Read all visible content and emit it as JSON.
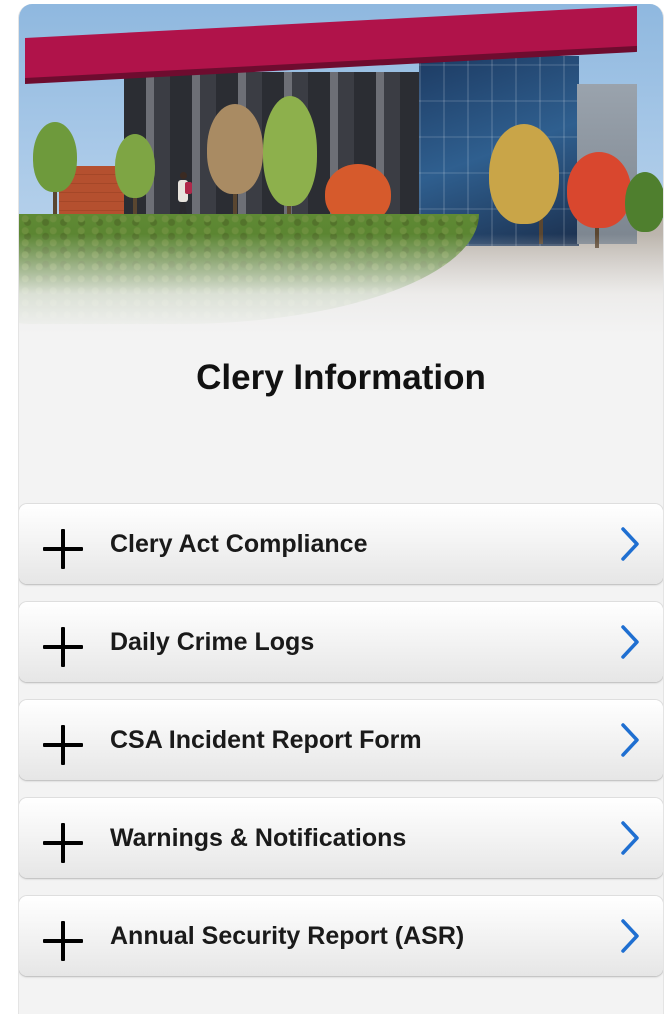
{
  "hero": {
    "image_subject": "campus building photo"
  },
  "page": {
    "title": "Clery Information"
  },
  "accordion": {
    "items": [
      {
        "label": "Clery Act Compliance",
        "icon": "plus-icon",
        "action_icon": "chevron-right-icon"
      },
      {
        "label": "Daily Crime Logs",
        "icon": "plus-icon",
        "action_icon": "chevron-right-icon"
      },
      {
        "label": "CSA Incident Report Form",
        "icon": "plus-icon",
        "action_icon": "chevron-right-icon"
      },
      {
        "label": "Warnings & Notifications",
        "icon": "plus-icon",
        "action_icon": "chevron-right-icon"
      },
      {
        "label": "Annual Security Report (ASR)",
        "icon": "plus-icon",
        "action_icon": "chevron-right-icon"
      }
    ]
  },
  "colors": {
    "accent_chevron": "#1f6fd1",
    "plus": "#000000",
    "building_roof": "#b0134a",
    "card_background": "#f3f3f3"
  }
}
